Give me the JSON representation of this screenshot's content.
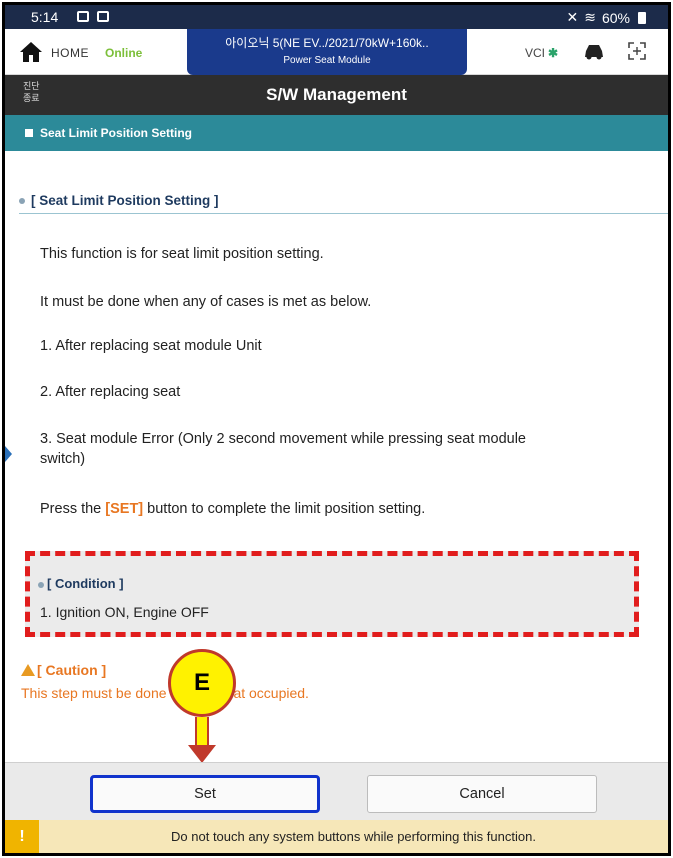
{
  "status_bar": {
    "time": "5:14",
    "battery": "60%"
  },
  "nav": {
    "home_label": "HOME",
    "online": "Online",
    "vehicle_line1": "아이오닉 5(NE EV../2021/70kW+160k..",
    "vehicle_line2": "Power Seat Module",
    "vci_label": "VCI"
  },
  "titlebar": {
    "side_label_1": "진단",
    "side_label_2": "종료",
    "title": "S/W Management"
  },
  "section": {
    "label": "Seat Limit Position Setting"
  },
  "content": {
    "subhead": "[ Seat Limit Position Setting ]",
    "p1": "This function is for seat limit position setting.",
    "p2": "It must be done when any of cases is met as below.",
    "p3": "1. After replacing seat module Unit",
    "p4": "2. After replacing seat",
    "p5_line1": "3. Seat module Error (Only 2 second movement while pressing seat module",
    "p5_line2": "switch)",
    "p6_before": "Press the ",
    "p6_set": "[SET]",
    "p6_after": " button to complete the limit position setting."
  },
  "condition": {
    "title": "[ Condition ]",
    "item": "1. Ignition ON, Engine OFF"
  },
  "caution": {
    "title": "[ Caution ]",
    "text": "This step must be done without seat occupied."
  },
  "marker": {
    "label": "E"
  },
  "buttons": {
    "set": "Set",
    "cancel": "Cancel"
  },
  "warning": {
    "icon": "!",
    "text": "Do not touch any system buttons while performing this function."
  },
  "colors": {
    "nav_blue": "#1a3a8c",
    "section_teal": "#2c8a99",
    "caution_orange": "#e87722",
    "highlight_red": "#e11d1d",
    "set_highlight": "#1133cc",
    "online_green": "#7cbf3a"
  }
}
